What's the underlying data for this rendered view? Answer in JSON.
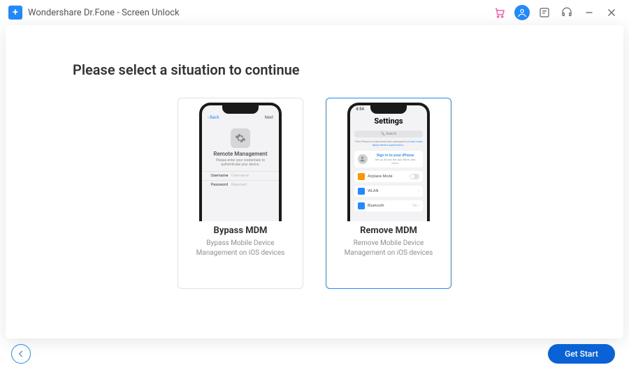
{
  "window": {
    "title": "Wondershare Dr.Fone - Screen Unlock"
  },
  "heading": "Please select a situation to continue",
  "cards": [
    {
      "title": "Bypass MDM",
      "desc": "Bypass Mobile Device Management on iOS devices",
      "selected": false,
      "screen": {
        "back": "Back",
        "next": "Next",
        "title": "Remote Management",
        "subtitle": "Please enter your credentials to authenticate your device.",
        "rows": [
          {
            "label": "Username",
            "placeholder": "Username"
          },
          {
            "label": "Password",
            "placeholder": "Required"
          }
        ]
      }
    },
    {
      "title": "Remove MDM",
      "desc": "Remove Mobile Device Management on iOS devices",
      "selected": true,
      "screen": {
        "time": "4:54",
        "title": "Settings",
        "search": "Search",
        "notice_prefix": "This iPhone is supervised and managed by",
        "notice_link": "Learn more about device supervision…",
        "signin": "Sign in to your iPhone",
        "signin_sub": "Set up iCloud, the App Store, and more.",
        "items": [
          {
            "label": "Airplane Mode",
            "color": "#ff9500",
            "toggle": true
          },
          {
            "label": "WLAN",
            "color": "#2389ff"
          },
          {
            "label": "Bluetooth",
            "color": "#2389ff",
            "value": "On"
          }
        ]
      }
    }
  ],
  "footer": {
    "primary": "Get Start"
  }
}
